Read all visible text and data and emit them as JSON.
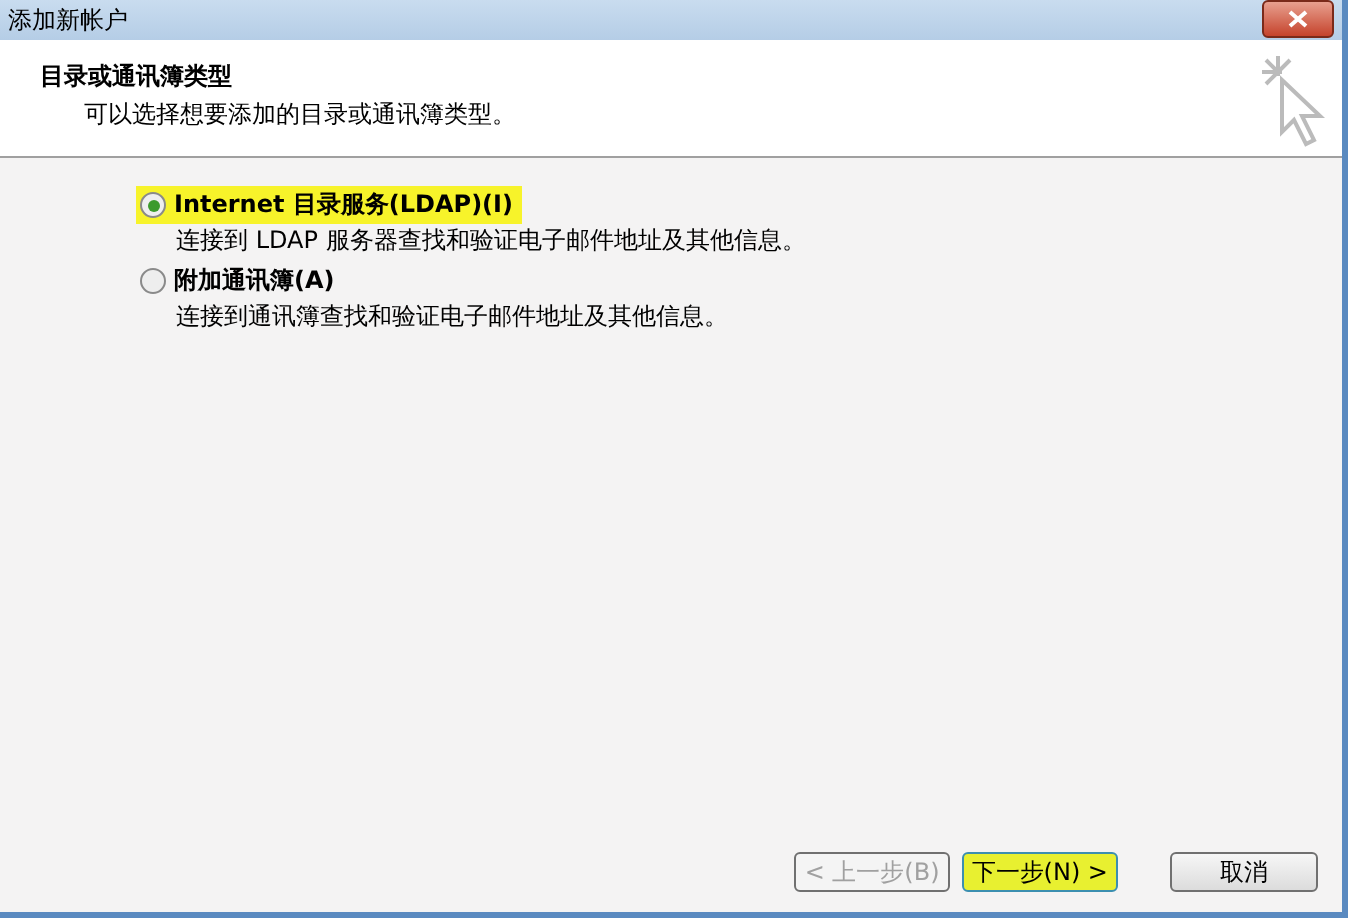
{
  "window": {
    "title": "添加新帐户"
  },
  "header": {
    "title": "目录或通讯簿类型",
    "subtitle": "可以选择想要添加的目录或通讯簿类型。"
  },
  "options": [
    {
      "label": "Internet 目录服务(LDAP)(I)",
      "description": "连接到 LDAP 服务器查找和验证电子邮件地址及其他信息。",
      "selected": true,
      "highlighted": true
    },
    {
      "label": "附加通讯簿(A)",
      "description": "连接到通讯簿查找和验证电子邮件地址及其他信息。",
      "selected": false,
      "highlighted": false
    }
  ],
  "buttons": [
    {
      "label": "< 上一步(B)",
      "disabled": true,
      "highlighted": false
    },
    {
      "label": "下一步(N) >",
      "disabled": false,
      "highlighted": true
    },
    {
      "label": "取消",
      "disabled": false,
      "highlighted": false
    }
  ]
}
